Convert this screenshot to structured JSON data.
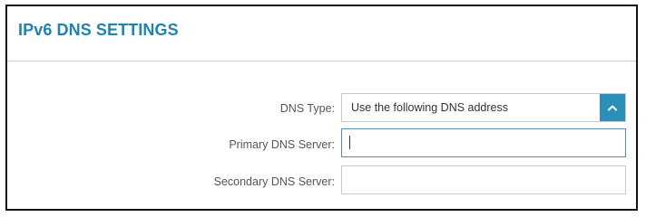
{
  "section": {
    "title": "IPv6 DNS SETTINGS"
  },
  "dns_type": {
    "label": "DNS Type:",
    "selected": "Use the following DNS address",
    "arrow_icon": "chevron-up-icon"
  },
  "primary_dns": {
    "label": "Primary DNS Server:",
    "value": "",
    "placeholder": ""
  },
  "secondary_dns": {
    "label": "Secondary DNS Server:",
    "value": "",
    "placeholder": ""
  },
  "colors": {
    "accent": "#2c8fb8",
    "title": "#1f84ad",
    "label_text": "#555555",
    "field_border": "#c9c9c9",
    "focused_border": "#5a8aa8",
    "panel_border": "#111111"
  }
}
